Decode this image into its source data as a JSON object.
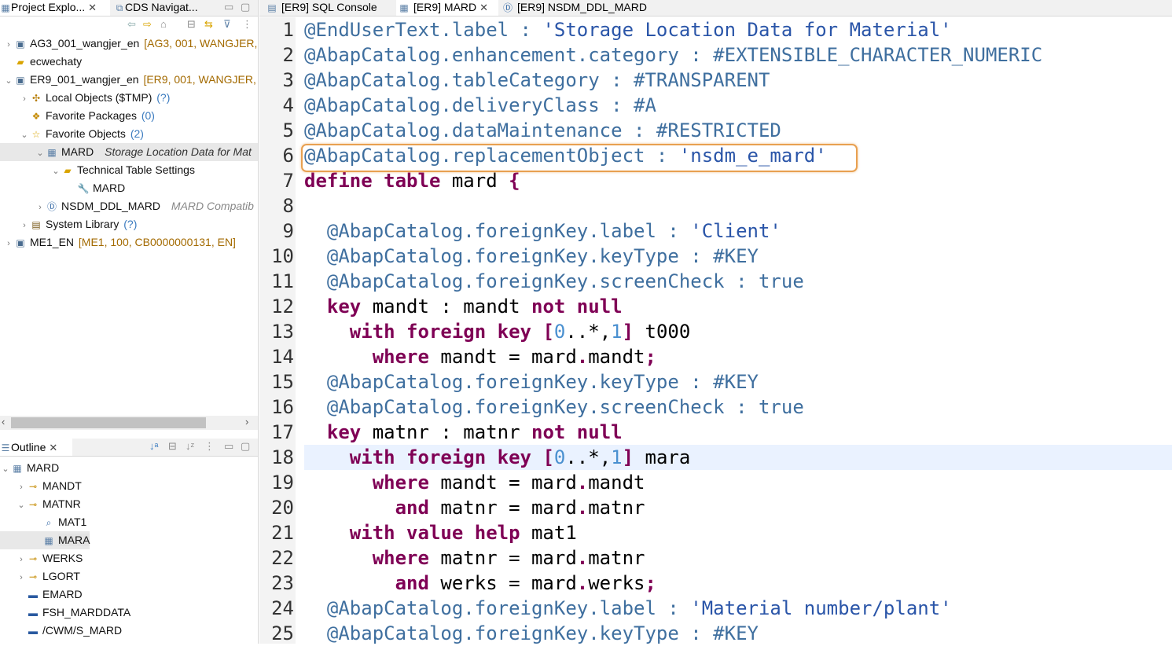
{
  "left_tabs": {
    "project_explorer": "Project Explo...",
    "cds_navigator": "CDS Navigat..."
  },
  "project_tree": [
    {
      "twisty": "›",
      "icon": "system-icon",
      "label": "AG3_001_wangjer_en",
      "decoration": "[AG3, 001, WANGJER,"
    },
    {
      "twisty": "",
      "icon": "folder-icon",
      "label": "ecwechaty",
      "decoration": ""
    },
    {
      "twisty": "⌄",
      "icon": "system-icon",
      "label": "ER9_001_wangjer_en",
      "decoration": "[ER9, 001, WANGJER, E"
    },
    {
      "twisty": "›",
      "icon": "local-objects-icon",
      "label": "Local Objects ($TMP)",
      "decoration": "(?)"
    },
    {
      "twisty": "",
      "icon": "package-icon",
      "label": "Favorite Packages",
      "decoration": "(0)"
    },
    {
      "twisty": "⌄",
      "icon": "star-icon",
      "label": "Favorite Objects",
      "decoration": "(2)"
    },
    {
      "twisty": "⌄",
      "icon": "table-icon",
      "label": "MARD",
      "decoration": "Storage Location Data for Mat"
    },
    {
      "twisty": "⌄",
      "icon": "folder-icon",
      "label": "Technical Table Settings",
      "decoration": ""
    },
    {
      "twisty": "",
      "icon": "wrench-icon",
      "label": "MARD",
      "decoration": ""
    },
    {
      "twisty": "›",
      "icon": "ddl-icon",
      "label": "NSDM_DDL_MARD",
      "decoration": "MARD Compatib"
    },
    {
      "twisty": "›",
      "icon": "library-icon",
      "label": "System Library",
      "decoration": "(?)"
    },
    {
      "twisty": "›",
      "icon": "system-icon",
      "label": "ME1_EN",
      "decoration": "[ME1, 100, CB0000000131, EN]"
    }
  ],
  "outline": {
    "title": "Outline",
    "items": [
      {
        "twisty": "⌄",
        "icon": "table-icon",
        "label": "MARD"
      },
      {
        "twisty": "›",
        "icon": "key-field-icon",
        "label": "MANDT"
      },
      {
        "twisty": "⌄",
        "icon": "key-field-icon",
        "label": "MATNR"
      },
      {
        "twisty": "",
        "icon": "search-help-icon",
        "label": "MAT1"
      },
      {
        "twisty": "",
        "icon": "table-icon",
        "label": "MARA"
      },
      {
        "twisty": "›",
        "icon": "key-field-icon",
        "label": "WERKS"
      },
      {
        "twisty": "›",
        "icon": "key-field-icon",
        "label": "LGORT"
      },
      {
        "twisty": "",
        "icon": "field-icon",
        "label": "EMARD"
      },
      {
        "twisty": "",
        "icon": "field-icon",
        "label": "FSH_MARDDATA"
      },
      {
        "twisty": "",
        "icon": "field-icon",
        "label": "/CWM/S_MARD"
      }
    ]
  },
  "editor_tabs": [
    {
      "icon": "sql-console-icon",
      "label": "[ER9] SQL Console"
    },
    {
      "icon": "table-icon",
      "label": "[ER9] MARD",
      "active": true
    },
    {
      "icon": "ddl-icon",
      "label": "[ER9] NSDM_DDL_MARD"
    }
  ],
  "code_lines": [
    {
      "n": "1",
      "t": [
        {
          "c": "an",
          "s": "@EndUserText.label : "
        },
        {
          "c": "str",
          "s": "'Storage Location Data for Material'"
        }
      ]
    },
    {
      "n": "2",
      "t": [
        {
          "c": "an",
          "s": "@AbapCatalog.enhancement.category : #EXTENSIBLE_CHARACTER_NUMERIC"
        }
      ]
    },
    {
      "n": "3",
      "t": [
        {
          "c": "an",
          "s": "@AbapCatalog.tableCategory : #TRANSPARENT"
        }
      ]
    },
    {
      "n": "4",
      "t": [
        {
          "c": "an",
          "s": "@AbapCatalog.deliveryClass : #A"
        }
      ]
    },
    {
      "n": "5",
      "t": [
        {
          "c": "an",
          "s": "@AbapCatalog.dataMaintenance : #RESTRICTED"
        }
      ]
    },
    {
      "n": "6",
      "t": [
        {
          "c": "an",
          "s": "@AbapCatalog.replacementObject : "
        },
        {
          "c": "str",
          "s": "'nsdm_e_mard'"
        }
      ]
    },
    {
      "n": "7",
      "t": [
        {
          "c": "kw",
          "s": "define table "
        },
        {
          "c": "",
          "s": "mard "
        },
        {
          "c": "kw",
          "s": "{"
        }
      ]
    },
    {
      "n": "8",
      "t": []
    },
    {
      "n": "9",
      "t": [
        {
          "c": "an",
          "s": "  @AbapCatalog.foreignKey.label : "
        },
        {
          "c": "str",
          "s": "'Client'"
        }
      ]
    },
    {
      "n": "10",
      "t": [
        {
          "c": "an",
          "s": "  @AbapCatalog.foreignKey.keyType : #KEY"
        }
      ]
    },
    {
      "n": "11",
      "t": [
        {
          "c": "an",
          "s": "  @AbapCatalog.foreignKey.screenCheck : true"
        }
      ]
    },
    {
      "n": "12",
      "t": [
        {
          "c": "kw",
          "s": "  key "
        },
        {
          "c": "",
          "s": "mandt : mandt "
        },
        {
          "c": "kw",
          "s": "not null"
        }
      ]
    },
    {
      "n": "13",
      "t": [
        {
          "c": "kw",
          "s": "    with foreign key "
        },
        {
          "c": "kw",
          "s": "["
        },
        {
          "c": "num",
          "s": "0"
        },
        {
          "c": "",
          "s": "..*,"
        },
        {
          "c": "num",
          "s": "1"
        },
        {
          "c": "kw",
          "s": "]"
        },
        {
          "c": "",
          "s": " t000"
        }
      ]
    },
    {
      "n": "14",
      "t": [
        {
          "c": "kw",
          "s": "      where "
        },
        {
          "c": "",
          "s": "mandt = mard"
        },
        {
          "c": "kw",
          "s": "."
        },
        {
          "c": "",
          "s": "mandt"
        },
        {
          "c": "kw",
          "s": ";"
        }
      ]
    },
    {
      "n": "15",
      "t": [
        {
          "c": "an",
          "s": "  @AbapCatalog.foreignKey.keyType : #KEY"
        }
      ]
    },
    {
      "n": "16",
      "t": [
        {
          "c": "an",
          "s": "  @AbapCatalog.foreignKey.screenCheck : true"
        }
      ]
    },
    {
      "n": "17",
      "t": [
        {
          "c": "kw",
          "s": "  key "
        },
        {
          "c": "",
          "s": "matnr : matnr "
        },
        {
          "c": "kw",
          "s": "not null"
        }
      ]
    },
    {
      "n": "18",
      "t": [
        {
          "c": "kw",
          "s": "    with foreign key "
        },
        {
          "c": "kw",
          "s": "["
        },
        {
          "c": "num",
          "s": "0"
        },
        {
          "c": "",
          "s": "..*,"
        },
        {
          "c": "num",
          "s": "1"
        },
        {
          "c": "kw",
          "s": "]"
        },
        {
          "c": "",
          "s": " mara"
        }
      ]
    },
    {
      "n": "19",
      "t": [
        {
          "c": "kw",
          "s": "      where "
        },
        {
          "c": "",
          "s": "mandt = mard"
        },
        {
          "c": "kw",
          "s": "."
        },
        {
          "c": "",
          "s": "mandt"
        }
      ]
    },
    {
      "n": "20",
      "t": [
        {
          "c": "kw",
          "s": "        and "
        },
        {
          "c": "",
          "s": "matnr = mard"
        },
        {
          "c": "kw",
          "s": "."
        },
        {
          "c": "",
          "s": "matnr"
        }
      ]
    },
    {
      "n": "21",
      "t": [
        {
          "c": "kw",
          "s": "    with value help "
        },
        {
          "c": "",
          "s": "mat1"
        }
      ]
    },
    {
      "n": "22",
      "t": [
        {
          "c": "kw",
          "s": "      where "
        },
        {
          "c": "",
          "s": "matnr = mard"
        },
        {
          "c": "kw",
          "s": "."
        },
        {
          "c": "",
          "s": "matnr"
        }
      ]
    },
    {
      "n": "23",
      "t": [
        {
          "c": "kw",
          "s": "        and "
        },
        {
          "c": "",
          "s": "werks = mard"
        },
        {
          "c": "kw",
          "s": "."
        },
        {
          "c": "",
          "s": "werks"
        },
        {
          "c": "kw",
          "s": ";"
        }
      ]
    },
    {
      "n": "24",
      "t": [
        {
          "c": "an",
          "s": "  @AbapCatalog.foreignKey.label : "
        },
        {
          "c": "str",
          "s": "'Material number/plant'"
        }
      ]
    },
    {
      "n": "25",
      "t": [
        {
          "c": "an",
          "s": "  @AbapCatalog.foreignKey.keyType : #KEY"
        }
      ]
    }
  ]
}
